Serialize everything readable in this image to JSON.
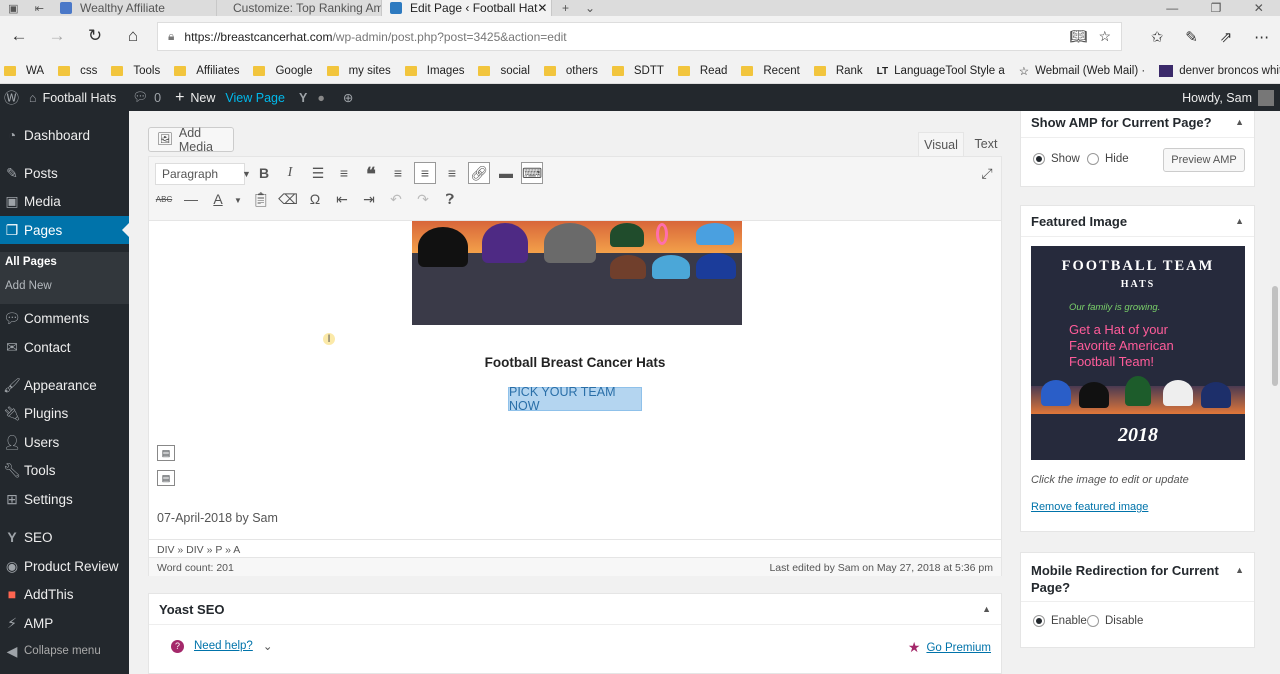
{
  "browser": {
    "tabs": [
      {
        "label": "Wealthy Affiliate"
      },
      {
        "label": "Customize: Top Ranking Am"
      },
      {
        "label": "Edit Page ‹ Football Hat"
      }
    ],
    "new_tab": "+",
    "url_host": "https://breastcancerhat.com",
    "url_path": "/wp-admin/post.php?post=3425&action=edit",
    "bookmarks": [
      "WA",
      "css",
      "Tools",
      "Affiliates",
      "Google",
      "my sites",
      "Images",
      "social",
      "others",
      "SDTT",
      "Read",
      "Recent",
      "Rank",
      "LanguageTool Style a",
      "Webmail (Web Mail) ·",
      "denver broncos white"
    ]
  },
  "adminbar": {
    "site": "Football Hats",
    "comments": "0",
    "new": "New",
    "view_page": "View Page",
    "howdy": "Howdy, Sam"
  },
  "sidebar": {
    "dashboard": "Dashboard",
    "posts": "Posts",
    "media": "Media",
    "pages": "Pages",
    "all_pages": "All Pages",
    "add_new": "Add New",
    "comments": "Comments",
    "contact": "Contact",
    "appearance": "Appearance",
    "plugins": "Plugins",
    "users": "Users",
    "tools": "Tools",
    "settings": "Settings",
    "seo": "SEO",
    "product_review": "Product Review",
    "addthis": "AddThis",
    "amp": "AMP",
    "collapse": "Collapse menu"
  },
  "editor": {
    "add_media": "Add Media",
    "tab_visual": "Visual",
    "tab_text": "Text",
    "format_select": "Paragraph",
    "heading": "Football Breast Cancer Hats",
    "cta": "PICK YOUR TEAM NOW",
    "byline": "07-April-2018 by Sam",
    "path": "DIV » DIV » P » A",
    "word_count": "Word count: 201",
    "last_edited": "Last edited by Sam on May 27, 2018 at 5:36 pm"
  },
  "yoast": {
    "title": "Yoast SEO",
    "need_help": "Need help?",
    "go_premium": "Go Premium"
  },
  "amp_box": {
    "title": "Show AMP for Current Page?",
    "show": "Show",
    "hide": "Hide",
    "preview": "Preview AMP"
  },
  "featured": {
    "title": "Featured Image",
    "img_line1": "FOOTBALL TEAM",
    "img_line2": "HATS",
    "img_line3": "Our family is growing.",
    "img_line4": "Get a Hat of your",
    "img_line5": "Favorite American",
    "img_line6": "Football Team!",
    "img_year": "2018",
    "hint": "Click the image to edit or update",
    "remove": "Remove featured image"
  },
  "mobile_box": {
    "title": "Mobile Redirection for Current Page?",
    "enable": "Enable",
    "disable": "Disable"
  },
  "colors": {
    "wp_dark": "#23282d",
    "wp_blue": "#0073aa",
    "accent_pink": "#ff5c9a"
  }
}
